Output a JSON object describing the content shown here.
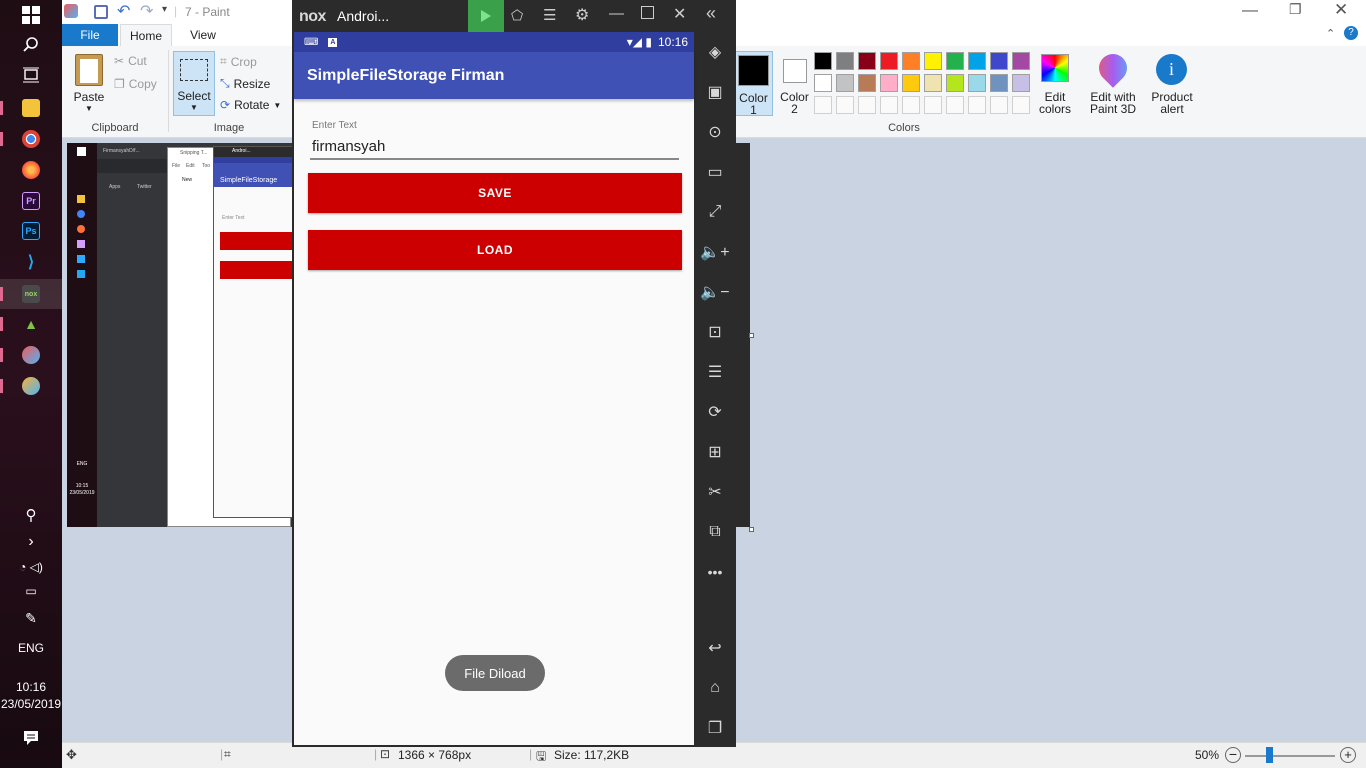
{
  "taskbar": {
    "lang": "ENG",
    "time": "10:16",
    "date": "23/05/2019"
  },
  "paint": {
    "title": "7 - Paint",
    "tabs": {
      "file": "File",
      "home": "Home",
      "view": "View"
    },
    "clipboard": {
      "paste": "Paste",
      "cut": "Cut",
      "copy": "Copy",
      "label": "Clipboard"
    },
    "image": {
      "select": "Select",
      "crop": "Crop",
      "resize": "Resize",
      "rotate": "Rotate",
      "label": "Image"
    },
    "colors": {
      "color1": "Color",
      "color1_num": "1",
      "color2": "Color",
      "color2_num": "2",
      "edit_colors_1": "Edit",
      "edit_colors_2": "colors",
      "edit_paint3d_1": "Edit with",
      "edit_paint3d_2": "Paint 3D",
      "product_alert_1": "Product",
      "product_alert_2": "alert",
      "label": "Colors",
      "palette_row1": [
        "#000000",
        "#7f7f7f",
        "#880015",
        "#ed1c24",
        "#ff7f27",
        "#fff200",
        "#22b14c",
        "#00a2e8",
        "#3f48cc",
        "#a349a4"
      ],
      "palette_row2": [
        "#ffffff",
        "#c3c3c3",
        "#b97a57",
        "#ffaec9",
        "#ffc90e",
        "#efe4b0",
        "#b5e61d",
        "#99d9ea",
        "#7092be",
        "#c8bfe7"
      ]
    },
    "status": {
      "dimensions": "1366 × 768px",
      "size": "Size: 117,2KB",
      "zoom": "50%"
    }
  },
  "nox": {
    "title": "Androi..."
  },
  "android": {
    "status_time": "10:16",
    "app_title": "SimpleFileStorage Firman",
    "input_label": "Enter Text",
    "input_value": "firmansyah",
    "save_button": "SAVE",
    "load_button": "LOAD",
    "toast": "File Diload"
  },
  "thumbnail": {
    "tab1": "FirmansyahD/f...",
    "tab2": "Snipping T...",
    "tab3": "Androi...",
    "apps": "Apps",
    "twitter": "Twitter",
    "menu_file": "File",
    "menu_edit": "Edit",
    "menu_tools": "Too",
    "new": "New",
    "app_title": "SimpleFileStorage",
    "enter_text": "Enter Text",
    "lang": "ENG",
    "time": "10:15",
    "date": "23/05/2019"
  }
}
